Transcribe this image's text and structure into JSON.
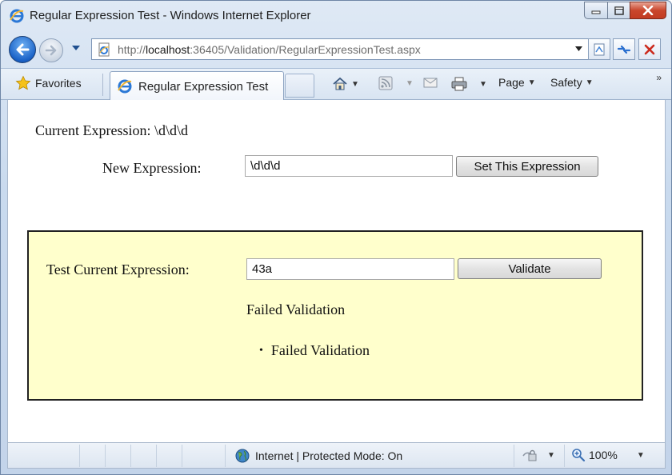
{
  "window": {
    "title": "Regular Expression Test - Windows Internet Explorer"
  },
  "address_bar": {
    "url_prefix": "http://",
    "url_host": "localhost",
    "url_rest": ":36405/Validation/RegularExpressionTest.aspx"
  },
  "command_bar": {
    "favorites_label": "Favorites",
    "tab_label": "Regular Expression Test",
    "page_label": "Page",
    "safety_label": "Safety",
    "overflow_glyph": "»"
  },
  "content": {
    "current_expression_label": "Current Expression:",
    "current_expression_value": "\\d\\d\\d",
    "new_expression_label": "New Expression:",
    "new_expression_value": "\\d\\d\\d",
    "set_button_label": "Set This Expression",
    "test_label": "Test Current Expression:",
    "test_value": "43a",
    "validate_button_label": "Validate",
    "validator_message": "Failed Validation",
    "summary_items": [
      "Failed Validation"
    ]
  },
  "status_bar": {
    "zone_text": "Internet | Protected Mode: On",
    "zoom_text": "100%"
  },
  "colors": {
    "panel_background": "#ffffcc",
    "close_button": "#c9462c",
    "ie_blue": "#1a62c7"
  },
  "icons": [
    "ie-logo-icon",
    "back-arrow-icon",
    "forward-arrow-icon",
    "favorites-star-icon",
    "home-icon",
    "rss-feeds-icon",
    "read-mail-icon",
    "print-icon",
    "compatibility-view-icon",
    "refresh-icon",
    "stop-icon",
    "globe-icon",
    "lock-icon",
    "zoom-icon"
  ]
}
